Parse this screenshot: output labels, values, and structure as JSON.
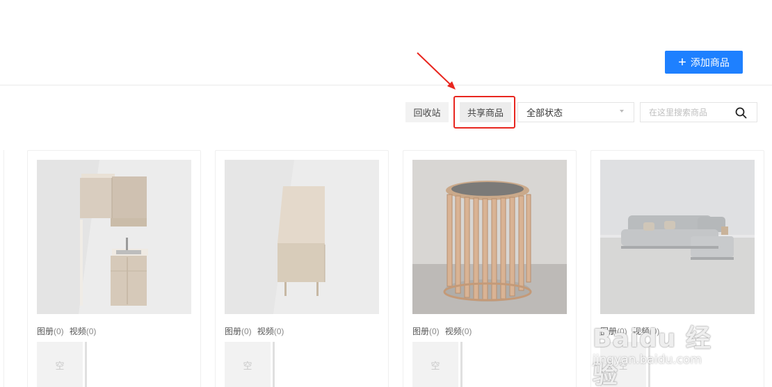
{
  "header": {
    "add_button_label": "添加商品"
  },
  "toolbar": {
    "recycle_label": "回收站",
    "shared_label": "共享商品",
    "status_select_value": "全部状态",
    "search_placeholder": "在这里搜索商品"
  },
  "products": [
    {
      "image": "kitchen-cabinet-render",
      "album_label": "图册",
      "album_count": "(0)",
      "video_label": "视频",
      "video_count": "(0)",
      "empty_label": "空"
    },
    {
      "image": "sideboard-render",
      "album_label": "图册",
      "album_count": "(0)",
      "video_label": "视频",
      "video_count": "(0)",
      "empty_label": "空"
    },
    {
      "image": "round-slatted-side-table-render",
      "album_label": "图册",
      "album_count": "(0)",
      "video_label": "视频",
      "video_count": "(0)",
      "empty_label": "空"
    },
    {
      "image": "sectional-sofa-render",
      "album_label": "图册",
      "album_count": "(0)",
      "video_label": "视频",
      "video_count": "(0)",
      "empty_label": "空"
    }
  ],
  "watermark": {
    "brand": "Baidu 经验",
    "url": "jingyan.baidu.com"
  },
  "colors": {
    "primary": "#1e80ff",
    "highlight_red": "#e8261f"
  }
}
